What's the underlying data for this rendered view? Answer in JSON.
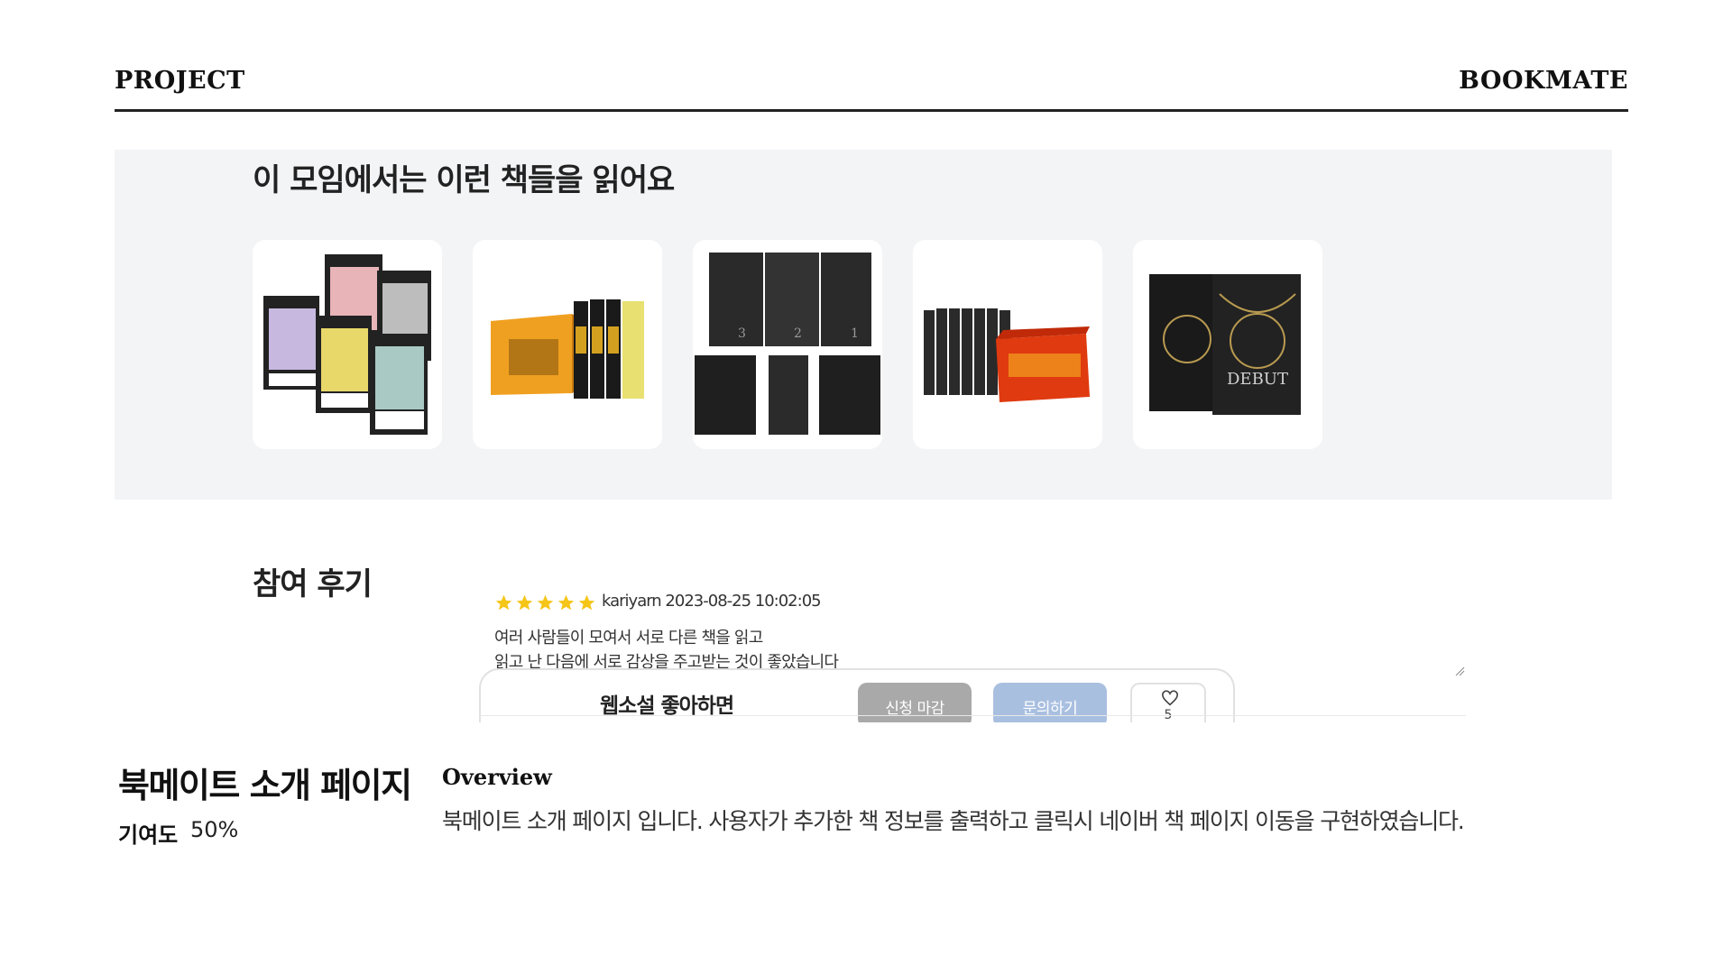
{
  "header": {
    "left_label": "PROJECT",
    "right_label": "BOOKMATE"
  },
  "books_section": {
    "title": "이 모임에서는 이런 책들을 읽어요",
    "books": [
      {
        "name": "book-cover-1"
      },
      {
        "name": "book-cover-2"
      },
      {
        "name": "book-cover-3"
      },
      {
        "name": "book-cover-4"
      },
      {
        "name": "book-cover-5"
      }
    ]
  },
  "reviews": {
    "title": "참여 후기",
    "rating": 5,
    "author_meta": "kariyarn 2023-08-25 10:02:05",
    "text_line1": "여러 사람들이 모여서 서로 다른 책을 읽고",
    "text_line2": "읽고 난 다음에 서로 감상을 주고받는 것이 좋았습니다"
  },
  "bottom_bar": {
    "title": "웹소설 좋아하면",
    "closed_button": "신청 마감",
    "ask_button": "문의하기",
    "like_count": "5"
  },
  "project": {
    "title": "북메이트 소개 페이지",
    "contribution_label": "기여도",
    "contribution_value": "50%",
    "overview_label": "Overview",
    "overview_text": "북메이트 소개 페이지 입니다. 사용자가 추가한 책 정보를 출력하고 클릭시 네이버 책 페이지 이동을 구현하였습니다."
  },
  "colors": {
    "panel_bg": "#f3f4f6",
    "star": "#f5c518",
    "closed_button": "#a9a9a9",
    "ask_button": "#a9bfe0"
  }
}
